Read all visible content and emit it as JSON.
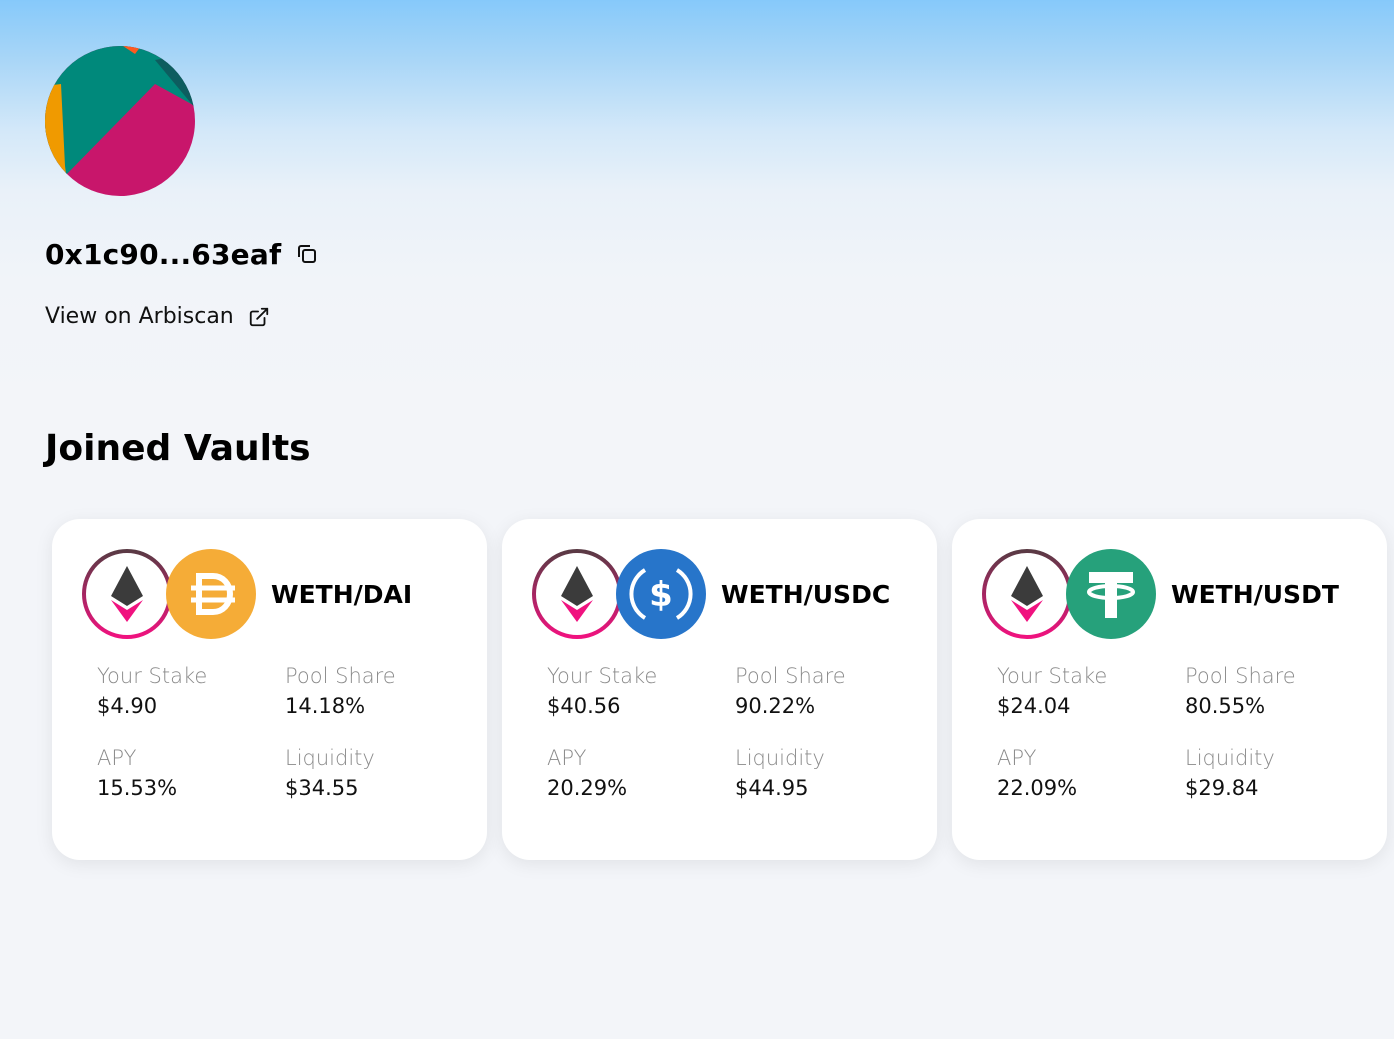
{
  "profile": {
    "address": "0x1c90...63eaf",
    "explorer_link": "View on Arbiscan"
  },
  "section": {
    "title": "Joined Vaults"
  },
  "vaults": [
    {
      "pair": "WETH/DAI",
      "token_a": "weth-icon",
      "token_b": "dai-icon",
      "stake_label": "Your Stake",
      "stake": "$4.90",
      "share_label": "Pool Share",
      "share": "14.18%",
      "apy_label": "APY",
      "apy": "15.53%",
      "liquidity_label": "Liquidity",
      "liquidity": "$34.55"
    },
    {
      "pair": "WETH/USDC",
      "token_a": "weth-icon",
      "token_b": "usdc-icon",
      "stake_label": "Your Stake",
      "stake": "$40.56",
      "share_label": "Pool Share",
      "share": "90.22%",
      "apy_label": "APY",
      "apy": "20.29%",
      "liquidity_label": "Liquidity",
      "liquidity": "$44.95"
    },
    {
      "pair": "WETH/USDT",
      "token_a": "weth-icon",
      "token_b": "usdt-icon",
      "stake_label": "Your Stake",
      "stake": "$24.04",
      "share_label": "Pool Share",
      "share": "80.55%",
      "apy_label": "APY",
      "apy": "22.09%",
      "liquidity_label": "Liquidity",
      "liquidity": "$29.84"
    }
  ],
  "colors": {
    "weth_ring": "#e0117f",
    "dai": "#f5ac37",
    "usdc": "#2775ca",
    "usdt": "#26a17b",
    "avatar_teal": "#00897b",
    "avatar_magenta": "#c8166b",
    "avatar_orange": "#f09a00"
  }
}
